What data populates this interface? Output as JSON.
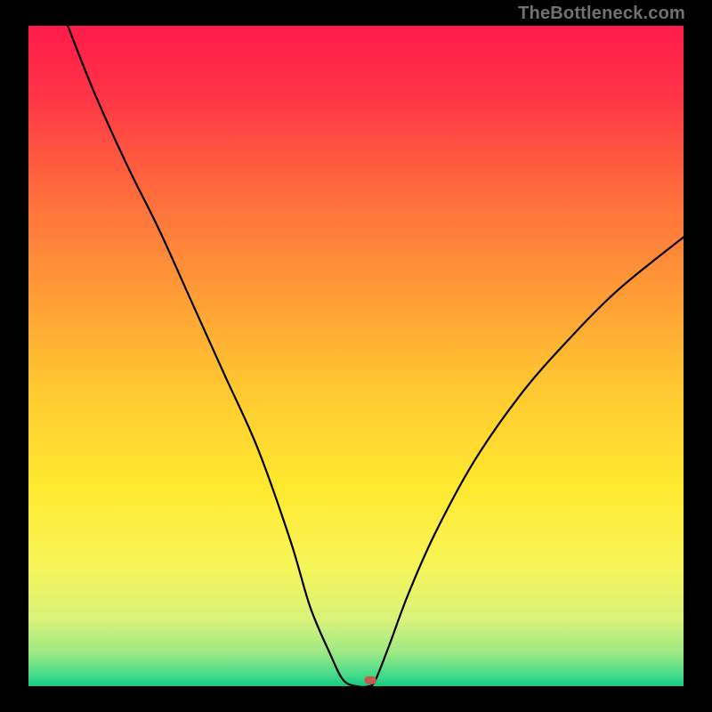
{
  "watermark": "TheBottleneck.com",
  "colors": {
    "frame": "#000000",
    "curve": "#000000",
    "marker": "#c65a4f"
  },
  "chart_data": {
    "type": "line",
    "title": "",
    "xlabel": "",
    "ylabel": "",
    "xlim": [
      0,
      100
    ],
    "ylim": [
      0,
      100
    ],
    "grid": false,
    "legend": false,
    "gradient_stops": [
      {
        "offset": 0.0,
        "color": "#ff1a4a"
      },
      {
        "offset": 0.1,
        "color": "#ff3346"
      },
      {
        "offset": 0.25,
        "color": "#ff6a3d"
      },
      {
        "offset": 0.4,
        "color": "#ff9a36"
      },
      {
        "offset": 0.55,
        "color": "#ffc830"
      },
      {
        "offset": 0.7,
        "color": "#ffe92f"
      },
      {
        "offset": 0.82,
        "color": "#f7f55a"
      },
      {
        "offset": 0.9,
        "color": "#d8f27a"
      },
      {
        "offset": 0.95,
        "color": "#9ce985"
      },
      {
        "offset": 0.985,
        "color": "#3fd98a"
      },
      {
        "offset": 1.0,
        "color": "#16c97e"
      }
    ],
    "series": [
      {
        "name": "bottleneck-curve",
        "x": [
          6,
          10,
          15,
          20,
          25,
          30,
          35,
          40,
          43,
          46,
          48,
          50,
          52,
          53,
          55,
          58,
          62,
          68,
          75,
          82,
          90,
          100
        ],
        "y": [
          100,
          90,
          79,
          69,
          58,
          47,
          36,
          22,
          12,
          5,
          1,
          0,
          0,
          1,
          6,
          14,
          23,
          34,
          44,
          52,
          60,
          68
        ]
      }
    ],
    "marker": {
      "x": 52.2,
      "y": 0.3,
      "w": 1.8,
      "h": 1.2
    }
  }
}
